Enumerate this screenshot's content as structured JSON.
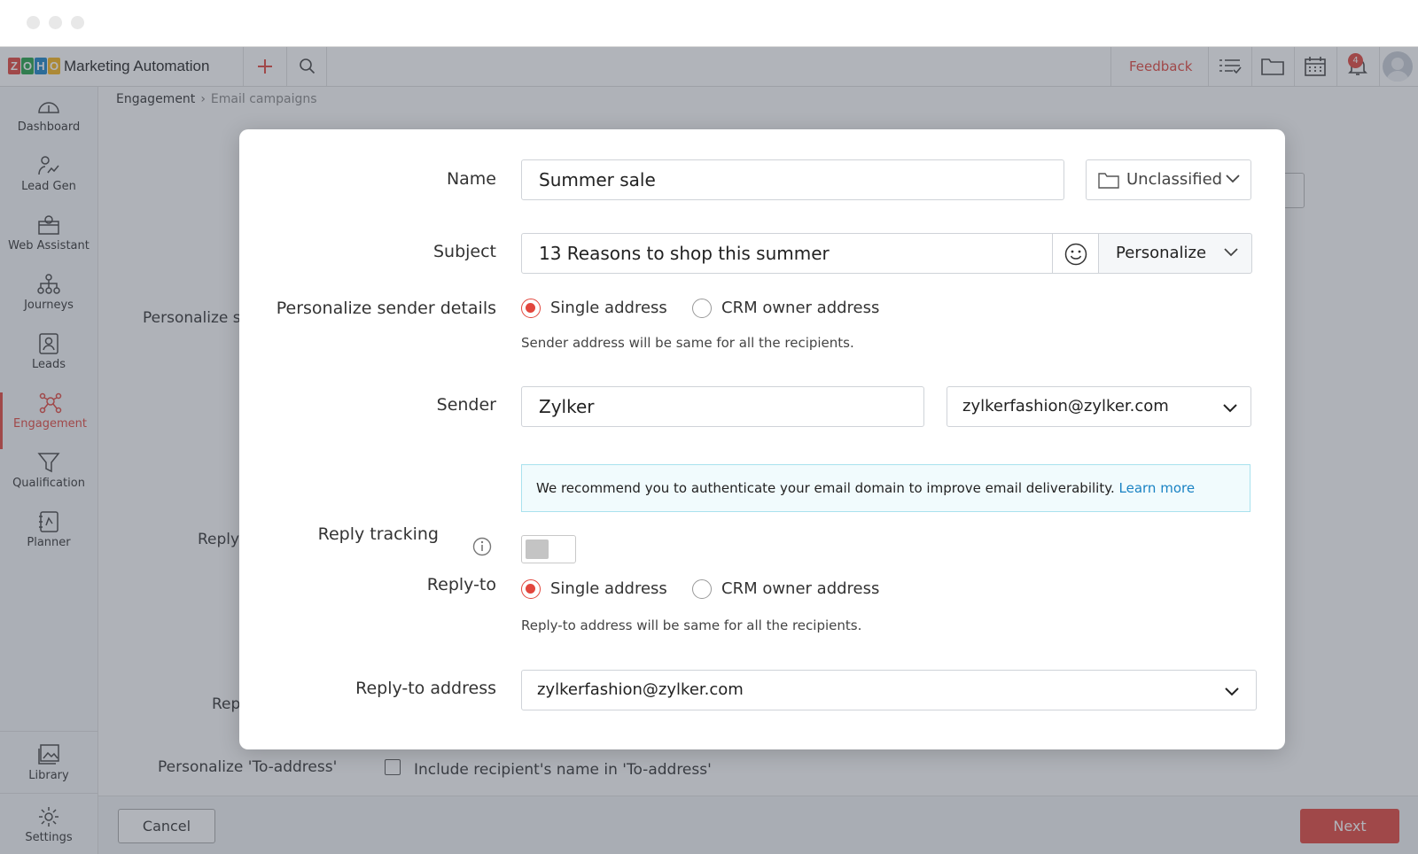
{
  "app": {
    "name": "Marketing Automation",
    "logo_letters": [
      "Z",
      "O",
      "H",
      "O"
    ],
    "logo_colors": [
      "#e2463d",
      "#24a047",
      "#1a83c4",
      "#f7b51c"
    ],
    "accent_color": "#e2463d"
  },
  "header": {
    "feedback_label": "Feedback",
    "notification_count": "4",
    "icons": [
      "plus-icon",
      "search-icon",
      "task-list-icon",
      "folder-icon",
      "calendar-icon",
      "bell-icon",
      "avatar"
    ]
  },
  "sidebar": {
    "items": [
      {
        "label": "Dashboard",
        "icon": "dashboard-icon",
        "active": false
      },
      {
        "label": "Lead Gen",
        "icon": "lead-gen-icon",
        "active": false
      },
      {
        "label": "Web Assistant",
        "icon": "web-assistant-icon",
        "active": false
      },
      {
        "label": "Journeys",
        "icon": "journeys-icon",
        "active": false
      },
      {
        "label": "Leads",
        "icon": "leads-icon",
        "active": false
      },
      {
        "label": "Engagement",
        "icon": "engagement-icon",
        "active": true
      },
      {
        "label": "Qualification",
        "icon": "qualification-icon",
        "active": false
      },
      {
        "label": "Planner",
        "icon": "planner-icon",
        "active": false
      }
    ],
    "bottom_items": [
      {
        "label": "Library",
        "icon": "library-icon"
      },
      {
        "label": "Settings",
        "icon": "gear-icon"
      }
    ]
  },
  "breadcrumb": {
    "items": [
      "Engagement",
      "Email campaigns"
    ]
  },
  "background": {
    "personalize_partial": "Personalize s",
    "reply_partial": "Reply",
    "rep_partial": "Rep",
    "personalize_to_label": "Personalize 'To-address'",
    "include_name_label": "Include recipient's name in 'To-address'"
  },
  "footer": {
    "cancel_label": "Cancel",
    "next_label": "Next"
  },
  "modal": {
    "name_label": "Name",
    "name_value": "Summer sale",
    "folder_value": "Unclassified",
    "subject_label": "Subject",
    "subject_value": "13 Reasons to shop this summer",
    "personalize_label": "Personalize",
    "sender_details_label": "Personalize sender details",
    "sender_options": [
      "Single address",
      "CRM owner address"
    ],
    "sender_selected": "Single address",
    "sender_hint": "Sender address will be same for all the recipients.",
    "sender_label": "Sender",
    "sender_name_value": "Zylker",
    "sender_email_value": "zylkerfashion@zylker.com",
    "recommend_text": "We recommend you to authenticate your email domain to improve email deliverability.",
    "learn_more_label": "Learn more",
    "reply_tracking_label": "Reply tracking",
    "reply_tracking_enabled": false,
    "reply_to_label": "Reply-to",
    "reply_to_options": [
      "Single address",
      "CRM owner address"
    ],
    "reply_to_selected": "Single address",
    "reply_to_hint": "Reply-to address will be same for all the recipients.",
    "reply_to_address_label": "Reply-to address",
    "reply_to_address_value": "zylkerfashion@zylker.com"
  }
}
